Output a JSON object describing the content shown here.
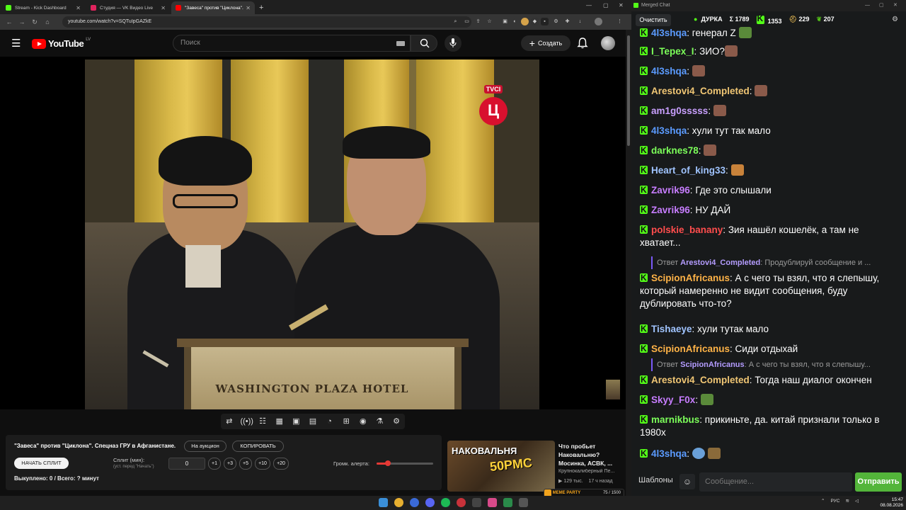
{
  "browser": {
    "tabs": [
      {
        "label": "Stream - Kick Dashboard",
        "favicon_color": "#53fc18",
        "active": false
      },
      {
        "label": "Студия — VK Видео Live",
        "favicon_color": "#e0245e",
        "active": false
      },
      {
        "label": "\"Завеса\" против \"Циклона\". Спецназ ГРУ в Афганистане",
        "favicon_color": "#ff0000",
        "active": true
      }
    ],
    "new_tab_icon": "+",
    "url": "youtube.com/watch?v=SQTuIpGAZkE"
  },
  "youtube": {
    "logo_text": "YouTube",
    "country_code": "LV",
    "search_placeholder": "Поиск",
    "create_label": "Создать"
  },
  "video": {
    "channel_watermark_label": "TVCI",
    "channel_watermark_letter": "Ц",
    "podium_text": "WASHINGTON PLAZA HOTEL"
  },
  "alert_panel": {
    "title": "\"Завеса\" против \"Циклона\". Спецназ ГРУ в Афганистане.",
    "auction_button": "На аукцион",
    "copy_button": "КОПИРОВАТЬ",
    "start_split_button": "НАЧАТЬ СПЛИТ",
    "split_label": "Сплит (мин):",
    "split_sublabel": "(уст. перед \"Начать\")",
    "split_value": "0",
    "add_buttons": [
      "+1",
      "+3",
      "+5",
      "+10",
      "+20"
    ],
    "volume_label": "Громк. алерта:",
    "volume_level": 0.2,
    "bought_text": "Выкуплено: 0 / Всего: ? минут"
  },
  "recommended": {
    "thumb_text": "НАКОВАЛЬНЯ",
    "thumb_number": "50PMC",
    "title": "Что пробьет Наковальню? Мосинка, АСВК, ...",
    "channel": "Крупнокалиберный Пе...",
    "views": "129 тыс.",
    "age": "17 ч назад"
  },
  "meme_party": {
    "label": "MEME PARTY",
    "counter": "75 / 1500"
  },
  "chat": {
    "window_title": "Merged Chat",
    "clear_button": "Очистить",
    "stats": [
      {
        "label": "ДУРКА",
        "color": "#53fc18"
      },
      {
        "label": "Σ 1789",
        "color": "#ffffff"
      },
      {
        "label": "1353",
        "color": "#53fc18"
      },
      {
        "label": "229",
        "color": "#f1c40f"
      },
      {
        "label": "207",
        "color": "#53fc18"
      }
    ],
    "messages": [
      {
        "user": "4l3shqa",
        "color": "#5b9bff",
        "text": "генерал Z"
      },
      {
        "user": "I_Tepex_I",
        "color": "#7cff5a",
        "text": "ЗИО?"
      },
      {
        "user": "4l3shqa",
        "color": "#5b9bff",
        "text": ""
      },
      {
        "user": "Arestovi4_Completed",
        "color": "#f0c674",
        "text": ""
      },
      {
        "user": "am1g0sssss",
        "color": "#c9a0ff",
        "text": ""
      },
      {
        "user": "4l3shqa",
        "color": "#5b9bff",
        "text": "хули тут так мало"
      },
      {
        "user": "darknes78",
        "color": "#7cff5a",
        "text": ""
      },
      {
        "user": "Heart_of_king33",
        "color": "#a0c4ff",
        "text": ""
      },
      {
        "user": "Zavrik96",
        "color": "#c77dff",
        "text": "Где это слышали"
      },
      {
        "user": "Zavrik96",
        "color": "#c77dff",
        "text": "НУ ДАЙ"
      },
      {
        "user": "polskie_banany",
        "color": "#ff4d4d",
        "text": "Зия нашёл кошелёк, а там не хватает..."
      },
      {
        "user": "ScipionAfricanus",
        "color": "#ffb347",
        "text": "А с чего ты взял, что я слепышу, который намеренно не видит сообщения, буду дублировать что-то?"
      },
      {
        "user": "Tishaeye",
        "color": "#a0c4ff",
        "text": "хули тутак мало"
      },
      {
        "user": "ScipionAfricanus",
        "color": "#ffb347",
        "text": "Сиди отдыхай"
      },
      {
        "user": "Arestovi4_Completed",
        "color": "#f0c674",
        "text": "Тогда наш диалог окончен"
      },
      {
        "user": "Skyy_F0x",
        "color": "#c77dff",
        "text": ""
      },
      {
        "user": "marnikbus",
        "color": "#7cff5a",
        "text": "прикиньте, да. китай признали только в 1980х"
      },
      {
        "user": "4l3shqa",
        "color": "#5b9bff",
        "text": ""
      }
    ],
    "replies": [
      {
        "prefix": "Ответ",
        "user": "Arestovi4_Completed",
        "text": "Продублируй сообщение и ..."
      },
      {
        "prefix": "Ответ",
        "user": "ScipionAfricanus",
        "text": "А с чего ты взял, что я слепышу..."
      }
    ],
    "templates_label": "Шаблоны",
    "input_placeholder": "Сообщение...",
    "send_button": "Отправить"
  },
  "taskbar": {
    "lang": "РУС",
    "time": "15:47",
    "date": "08.08.2026"
  }
}
